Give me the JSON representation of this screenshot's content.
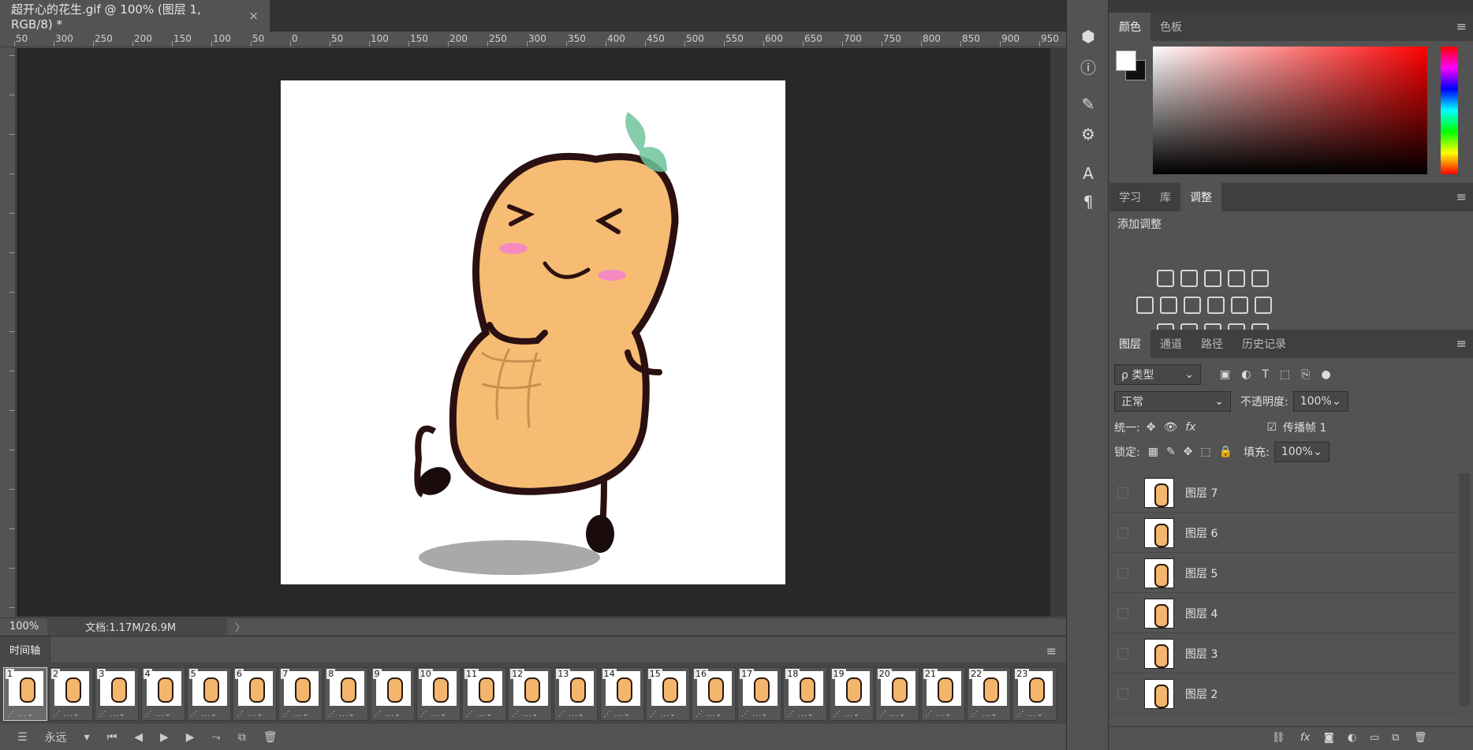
{
  "document": {
    "tab_title": "超开心的花生.gif @ 100% (图层 1, RGB/8) *",
    "close_glyph": "×"
  },
  "ruler": {
    "top_labels": [
      "50",
      "300",
      "250",
      "200",
      "150",
      "100",
      "50",
      "0",
      "50",
      "100",
      "150",
      "200",
      "250",
      "300",
      "350",
      "400",
      "450",
      "500",
      "550",
      "600",
      "650",
      "700",
      "750",
      "800",
      "850",
      "900",
      "950"
    ]
  },
  "status": {
    "zoom": "100%",
    "doc_info": "文档:1.17M/26.9M",
    "arrow": "〉"
  },
  "timeline": {
    "title": "时间轴",
    "menu_icon": "≡",
    "frames": [
      "1",
      "2",
      "3",
      "4",
      "5",
      "6",
      "7",
      "8",
      "9",
      "10",
      "11",
      "12",
      "13",
      "14",
      "15",
      "16",
      "17",
      "18",
      "19",
      "20",
      "21",
      "22",
      "23"
    ],
    "frame_meta": "⋰ ...⌄",
    "loop": "永远"
  },
  "color_panel": {
    "tabs": [
      "颜色",
      "色板"
    ],
    "active": 0
  },
  "adjustments_panel": {
    "tabs": [
      "学习",
      "库",
      "调整"
    ],
    "active": 2,
    "title": "添加调整"
  },
  "layers_panel": {
    "tabs": [
      "图层",
      "通道",
      "路径",
      "历史记录"
    ],
    "active": 0,
    "filter_label": "ρ 类型",
    "blend_mode": "正常",
    "opacity_label": "不透明度:",
    "opacity_value": "100%",
    "unify_label": "统一:",
    "propagate_label": "传播帧 1",
    "lock_label": "锁定:",
    "fill_label": "填充:",
    "fill_value": "100%",
    "layers": [
      "图层 7",
      "图层 6",
      "图层 5",
      "图层 4",
      "图层 3",
      "图层 2"
    ]
  },
  "colors": {
    "fg": "#ffffff",
    "bg": "#111111",
    "peanut": "#f3b66c"
  }
}
